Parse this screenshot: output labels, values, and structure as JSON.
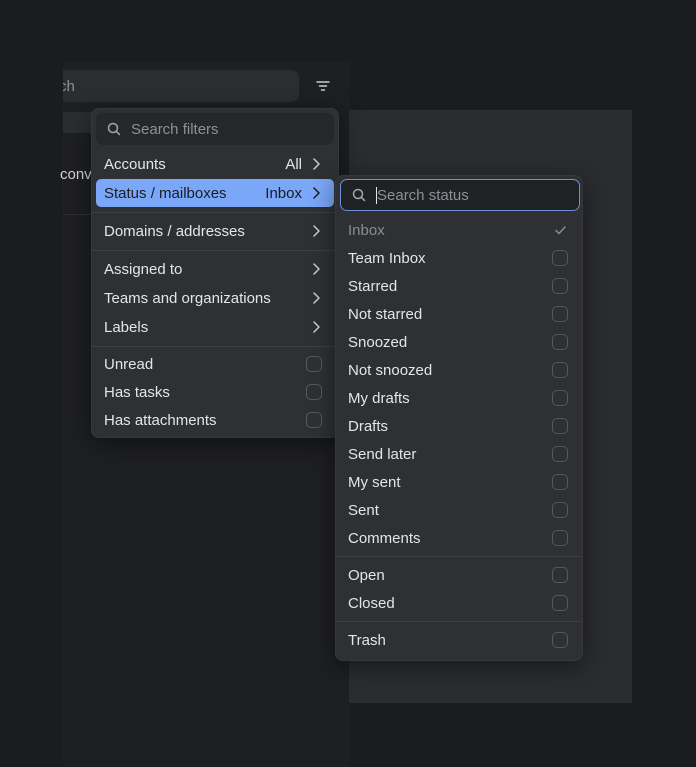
{
  "background": {
    "search_partial": "ch",
    "conversation_partial": "conv"
  },
  "filter_menu": {
    "search_placeholder": "Search filters",
    "items": [
      {
        "label": "Accounts",
        "value": "All"
      },
      {
        "label": "Status / mailboxes",
        "value": "Inbox"
      },
      {
        "label": "Domains / addresses"
      },
      {
        "label": "Assigned to"
      },
      {
        "label": "Teams and organizations"
      },
      {
        "label": "Labels"
      },
      {
        "label": "Unread"
      },
      {
        "label": "Has tasks"
      },
      {
        "label": "Has attachments"
      }
    ]
  },
  "status_menu": {
    "search_placeholder": "Search status",
    "items": [
      {
        "label": "Inbox",
        "checked": true
      },
      {
        "label": "Team Inbox"
      },
      {
        "label": "Starred"
      },
      {
        "label": "Not starred"
      },
      {
        "label": "Snoozed"
      },
      {
        "label": "Not snoozed"
      },
      {
        "label": "My drafts"
      },
      {
        "label": "Drafts"
      },
      {
        "label": "Send later"
      },
      {
        "label": "My sent"
      },
      {
        "label": "Sent"
      },
      {
        "label": "Comments"
      },
      {
        "label": "Open"
      },
      {
        "label": "Closed"
      },
      {
        "label": "Trash"
      }
    ]
  },
  "colors": {
    "accent": "#7aa7f7",
    "menu_bg": "#2e3034",
    "page_bg": "#1b1c1f"
  }
}
